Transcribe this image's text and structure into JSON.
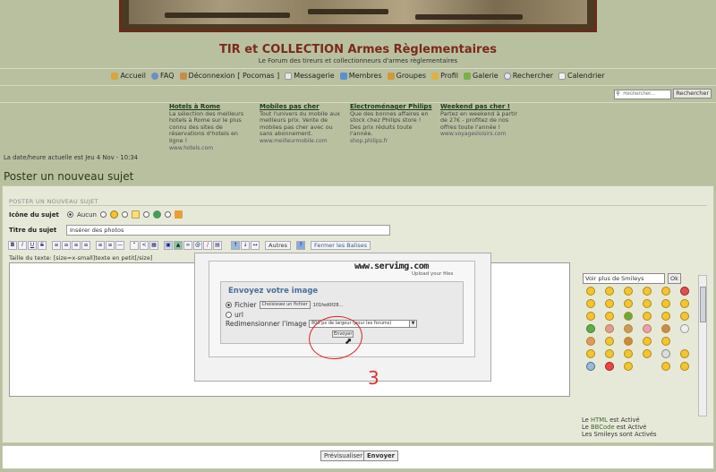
{
  "site": {
    "title": "TIR et COLLECTION Armes Règlementaires",
    "description": "Le Forum des tireurs et collectionneurs d'armes règlementaires"
  },
  "nav": [
    {
      "label": "Accueil",
      "icon": "home-icon"
    },
    {
      "label": "FAQ",
      "icon": "faq-icon"
    },
    {
      "label": "Déconnexion [ Pocomas ]",
      "icon": "logout-icon"
    },
    {
      "label": "Messagerie",
      "icon": "mail-icon"
    },
    {
      "label": "Membres",
      "icon": "members-icon"
    },
    {
      "label": "Groupes",
      "icon": "groups-icon"
    },
    {
      "label": "Profil",
      "icon": "profile-icon"
    },
    {
      "label": "Galerie",
      "icon": "gallery-icon"
    },
    {
      "label": "Rechercher",
      "icon": "search-icon"
    },
    {
      "label": "Calendrier",
      "icon": "calendar-icon"
    }
  ],
  "search": {
    "placeholder": "Rechercher...",
    "button": "Rechercher"
  },
  "ads": [
    {
      "title": "Hotels à Rome",
      "text": "La sélection des meilleurs hotels à Rome sur le plus connu des sites de réservations d'hotels en ligne !",
      "url": "www.hotels.com"
    },
    {
      "title": "Mobiles pas cher",
      "text": "Tout l'univers du mobile aux meilleurs prix. Vente de mobiles pas cher avec ou sans abonnement.",
      "url": "www.meilleurmobile.com"
    },
    {
      "title": "Electroménager Philips",
      "text": "Que des bonnes affaires en stock chez Philips store ! Des prix réduits toute l'année.",
      "url": "shop.philips.fr"
    },
    {
      "title": "Weekend pas cher !",
      "text": "Partez en weekend à partir de 27€ - profitez de nos offres toute l'année !",
      "url": "www.voyagesloisirs.com"
    }
  ],
  "date_text": "La date/heure actuelle est Jeu 4 Nov - 10:34",
  "page_title": "Poster un nouveau sujet",
  "section_title": "POSTER UN NOUVEAU SUJET",
  "form": {
    "icon_label": "Icône du sujet",
    "icon_none": "Aucun",
    "subject_label": "Titre du sujet",
    "subject_value": "Insérer des photos",
    "toolbar_autres": "Autres",
    "toolbar_close_tags": "Fermer les Balises",
    "hint": "Taille du texte: [size=x-small]texte en petit[/size]"
  },
  "smileys": {
    "select_label": "Voir plus de Smileys",
    "ok": "Ok"
  },
  "status": {
    "html_pre": "Le ",
    "html_word": "HTML",
    "html_post": " est ",
    "html_state": "Activé",
    "bbcode_pre": "Le ",
    "bbcode_word": "BBCode",
    "bbcode_post": " est ",
    "bbcode_state": "Activé",
    "smileys_text": "Les Smileys sont ",
    "smileys_state": "Activés"
  },
  "buttons": {
    "preview": "Prévisualiser",
    "send": "Envoyer"
  },
  "upload": {
    "logo": "www.servimg.com",
    "logo_sub": "Upload your files",
    "title": "Envoyez votre image",
    "file_label": "Fichier",
    "choose_button": "Choisissez un fichier",
    "file_name": "101fed0f28...",
    "url_label": "url",
    "resize_label": "Redimensionner l'image",
    "resize_value": "800 px de largeur (pour les forums)",
    "send_button": "Envoyer"
  },
  "annotation_number": "3",
  "colors": {
    "title": "#7a2a1a",
    "background": "#b9c0a0",
    "panel": "#e7e9d8",
    "annotation": "#e02020"
  }
}
